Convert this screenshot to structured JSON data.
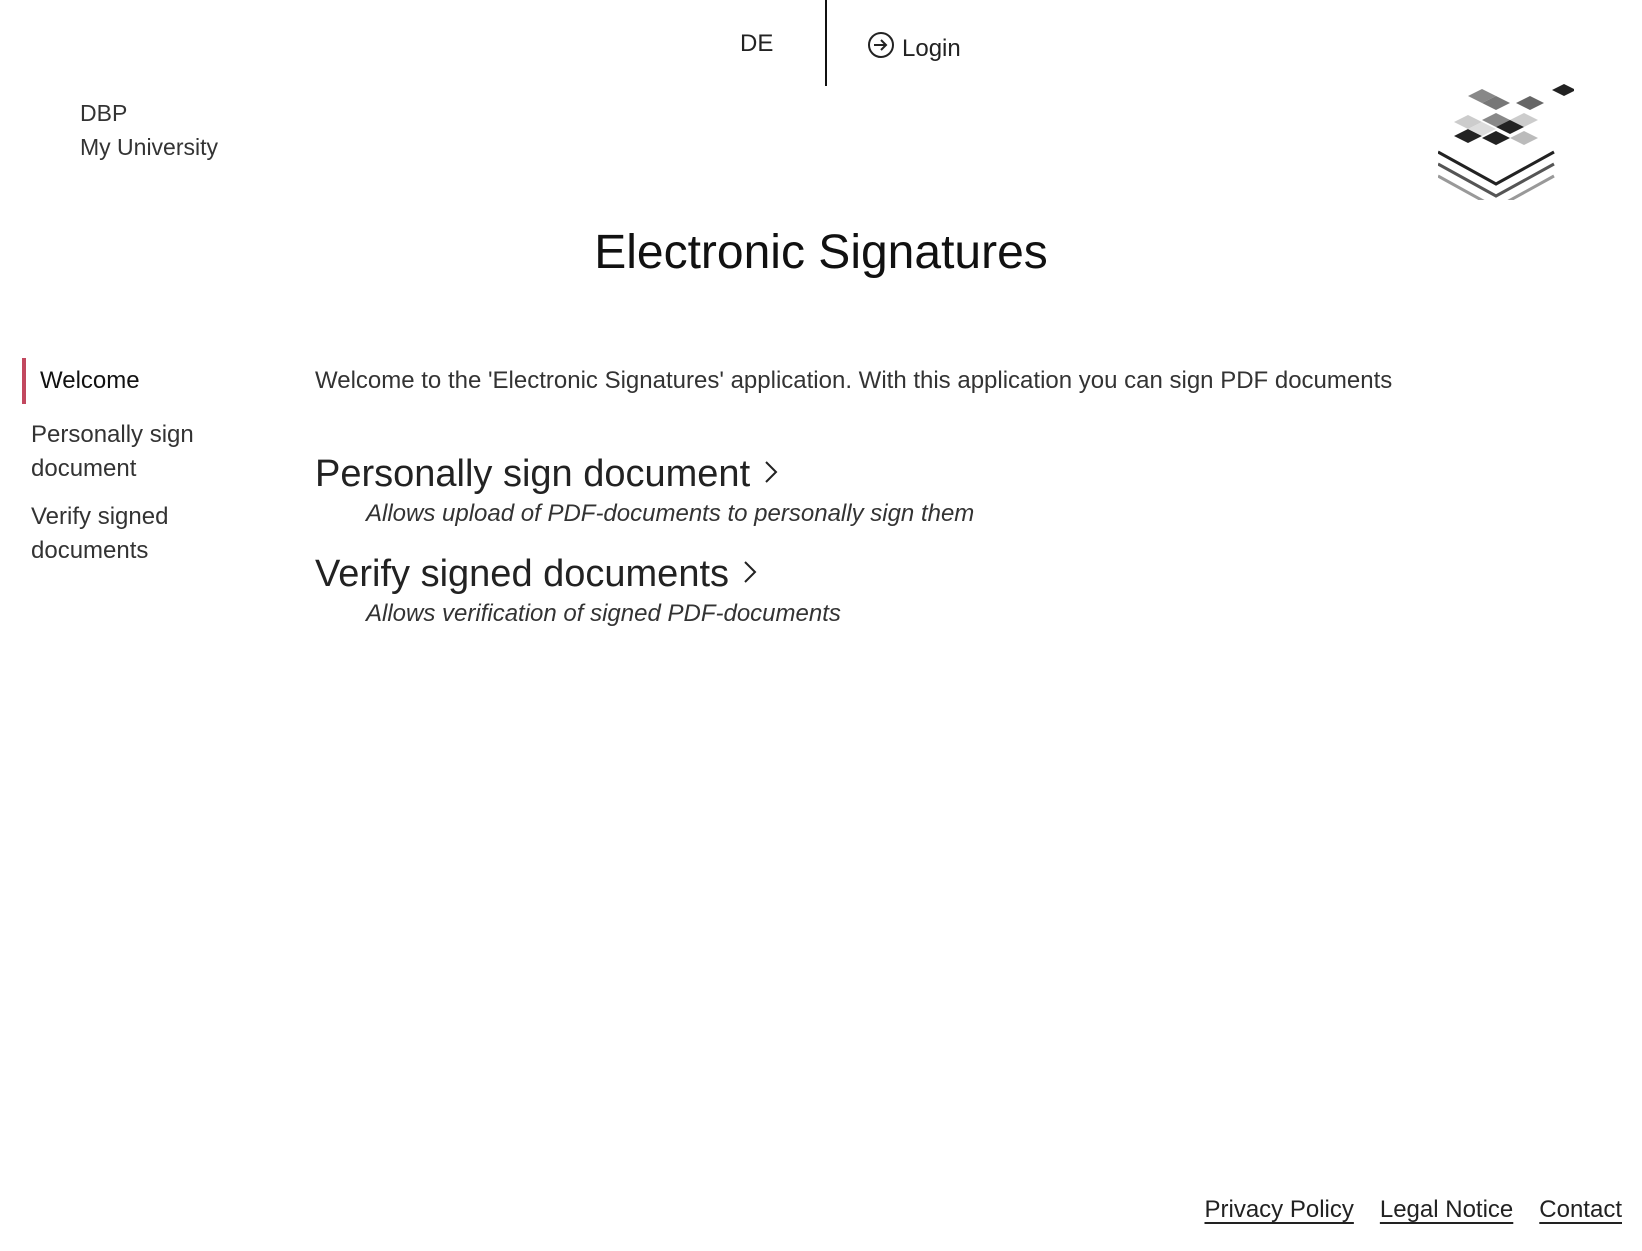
{
  "header": {
    "language_label": "DE",
    "login_label": "Login"
  },
  "brand": {
    "line1": "DBP",
    "line2": "My University"
  },
  "page": {
    "title": "Electronic Signatures"
  },
  "sidebar": {
    "items": [
      {
        "label": "Welcome",
        "active": true
      },
      {
        "label": "Personally sign document",
        "active": false
      },
      {
        "label": "Verify signed documents",
        "active": false
      }
    ]
  },
  "main": {
    "welcome_text": "Welcome to the 'Electronic Signatures' application. With this application you can sign PDF documents",
    "actions": [
      {
        "label": "Personally sign document",
        "description": "Allows upload of PDF-documents to personally sign them"
      },
      {
        "label": "Verify signed documents",
        "description": "Allows verification of signed PDF-documents"
      }
    ]
  },
  "footer": {
    "links": [
      "Privacy Policy",
      "Legal Notice",
      "Contact"
    ]
  },
  "colors": {
    "accent": "#c2485f"
  }
}
